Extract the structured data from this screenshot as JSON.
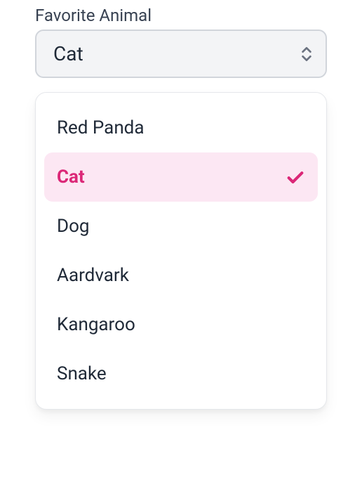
{
  "field": {
    "label": "Favorite Animal",
    "selected_value": "Cat"
  },
  "options": [
    {
      "label": "Red Panda",
      "selected": false
    },
    {
      "label": "Cat",
      "selected": true
    },
    {
      "label": "Dog",
      "selected": false
    },
    {
      "label": "Aardvark",
      "selected": false
    },
    {
      "label": "Kangaroo",
      "selected": false
    },
    {
      "label": "Snake",
      "selected": false
    }
  ],
  "colors": {
    "accent": "#db2777",
    "accent_bg": "#fce7f3",
    "text": "#1f2937",
    "label": "#374151",
    "button_bg": "#f3f4f6",
    "button_border": "#d1d5db"
  }
}
